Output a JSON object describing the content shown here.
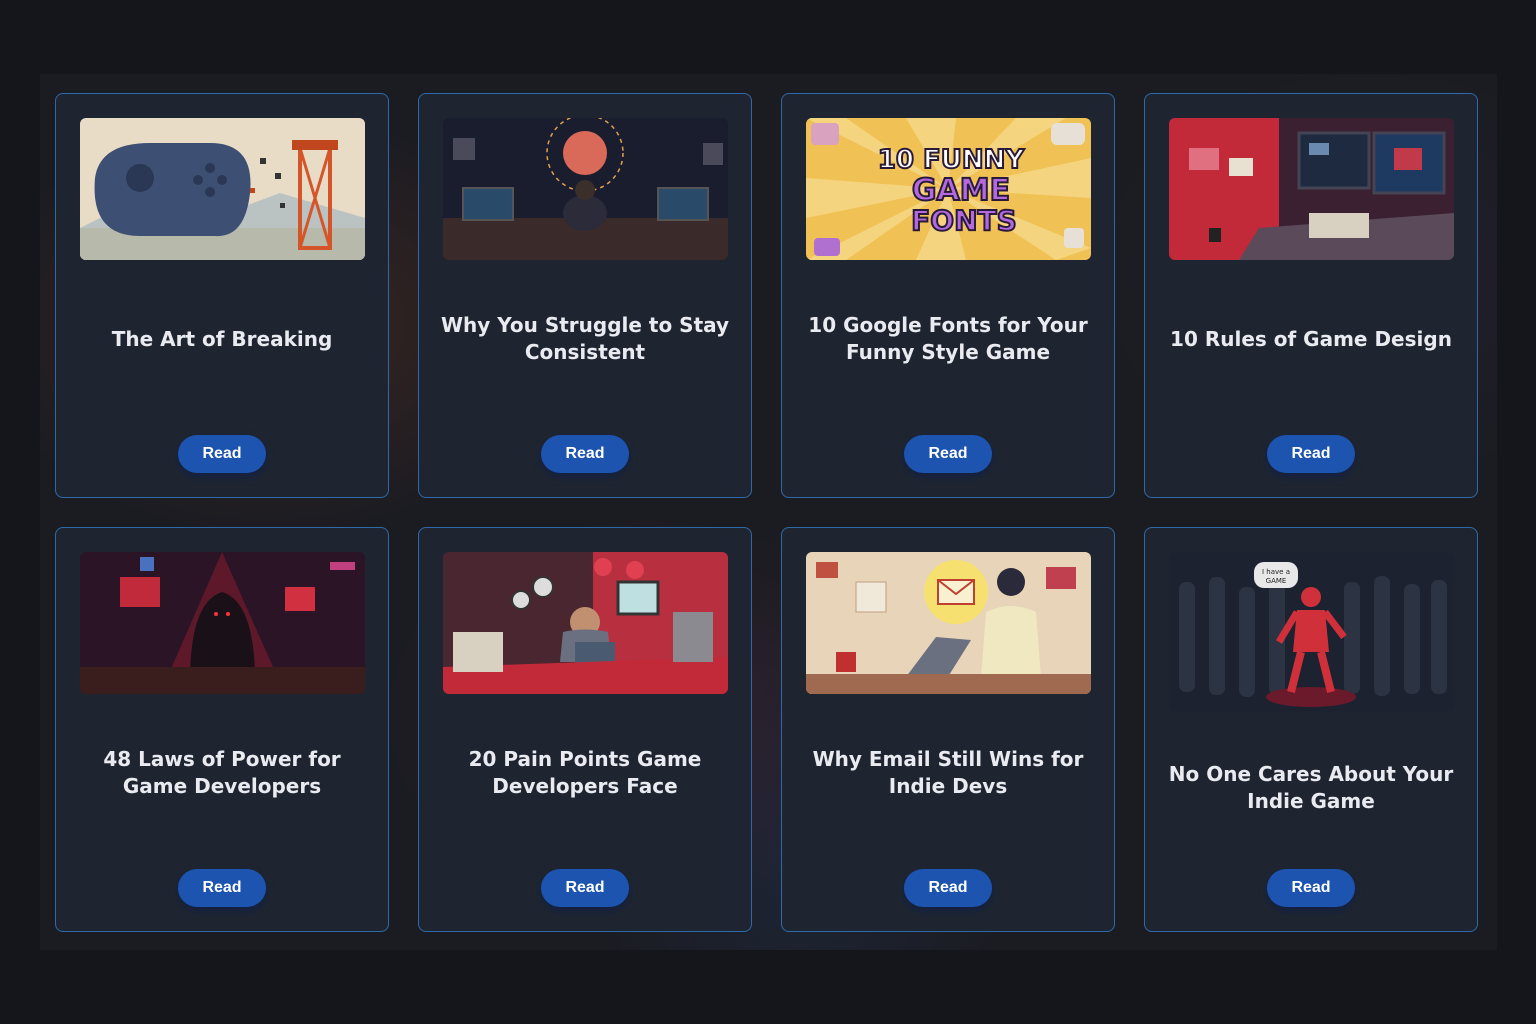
{
  "cards": [
    {
      "title": "The Art of Breaking",
      "button": "Read",
      "image": "game-controller-construction-illustration"
    },
    {
      "title": "Why You Struggle to Stay Consistent",
      "button": "Read",
      "image": "brain-over-desk-illustration"
    },
    {
      "title": "10 Google Fonts for Your Funny Style Game",
      "button": "Read",
      "image": "funny-game-fonts-banner",
      "image_text": "10 FUNNY GAME FONTS"
    },
    {
      "title": "10 Rules of Game Design",
      "button": "Read",
      "image": "game-dev-desk-illustration"
    },
    {
      "title": "48 Laws of Power for Game Developers",
      "button": "Read",
      "image": "hooded-figure-illustration"
    },
    {
      "title": "20 Pain Points Game Developers Face",
      "button": "Read",
      "image": "stressed-developer-illustration"
    },
    {
      "title": "Why Email Still Wins for Indie Devs",
      "button": "Read",
      "image": "email-developer-illustration"
    },
    {
      "title": "No One Cares About Your Indie Game",
      "button": "Read",
      "image": "red-figure-in-crowd-illustration",
      "image_text": "I have a GAME"
    }
  ],
  "colors": {
    "page_bg": "#15161b",
    "card_bg": "#1f2530",
    "card_border": "#2f6aa8",
    "button_bg": "#1d54b0",
    "title_text": "#e9ebf0"
  }
}
